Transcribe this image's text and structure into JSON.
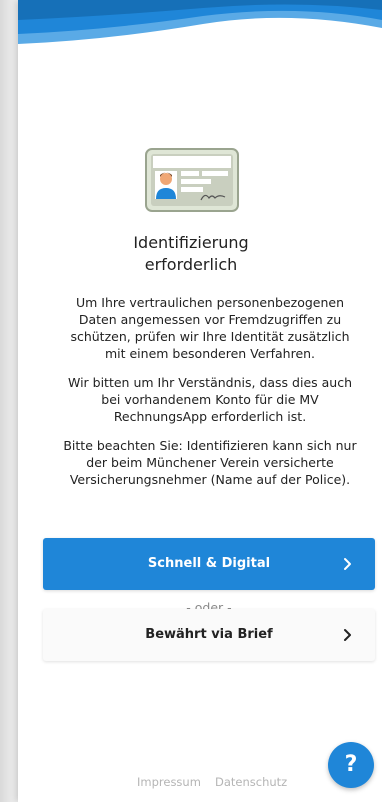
{
  "title": {
    "line1": "Identifizierung",
    "line2": "erforderlich"
  },
  "paragraphs": [
    {
      "lines": [
        "Um Ihre vertraulichen personenbezogenen",
        "Daten angemessen vor Fremdzugriffen zu",
        "schützen, prüfen wir Ihre Identität zusätzlich",
        "mit einem besonderen Verfahren."
      ]
    },
    {
      "lines": [
        "Wir bitten um Ihr Verständnis, dass dies auch",
        "bei vorhandenem Konto für die MV",
        "RechnungsApp erforderlich ist."
      ]
    },
    {
      "lines": [
        "Bitte beachten Sie: Identifizieren kann sich nur",
        "der beim Münchener Verein versicherte",
        "Versicherungsnehmer (Name auf der Police)."
      ]
    }
  ],
  "buttons": {
    "digital": "Schnell & Digital",
    "separator": "- oder -",
    "brief": "Bewährt via Brief"
  },
  "footer": {
    "impressum": "Impressum",
    "datenschutz": "Datenschutz"
  },
  "help": {
    "label": "?"
  },
  "icons": {
    "card": "id-card-icon",
    "chevron": "chevron-right-icon",
    "help": "question-mark-icon"
  },
  "colors": {
    "primary": "#1f86d8",
    "wave_light": "#5aaae6",
    "text": "#222222",
    "muted": "#8a8a8a",
    "footer": "#b5b5b5"
  }
}
